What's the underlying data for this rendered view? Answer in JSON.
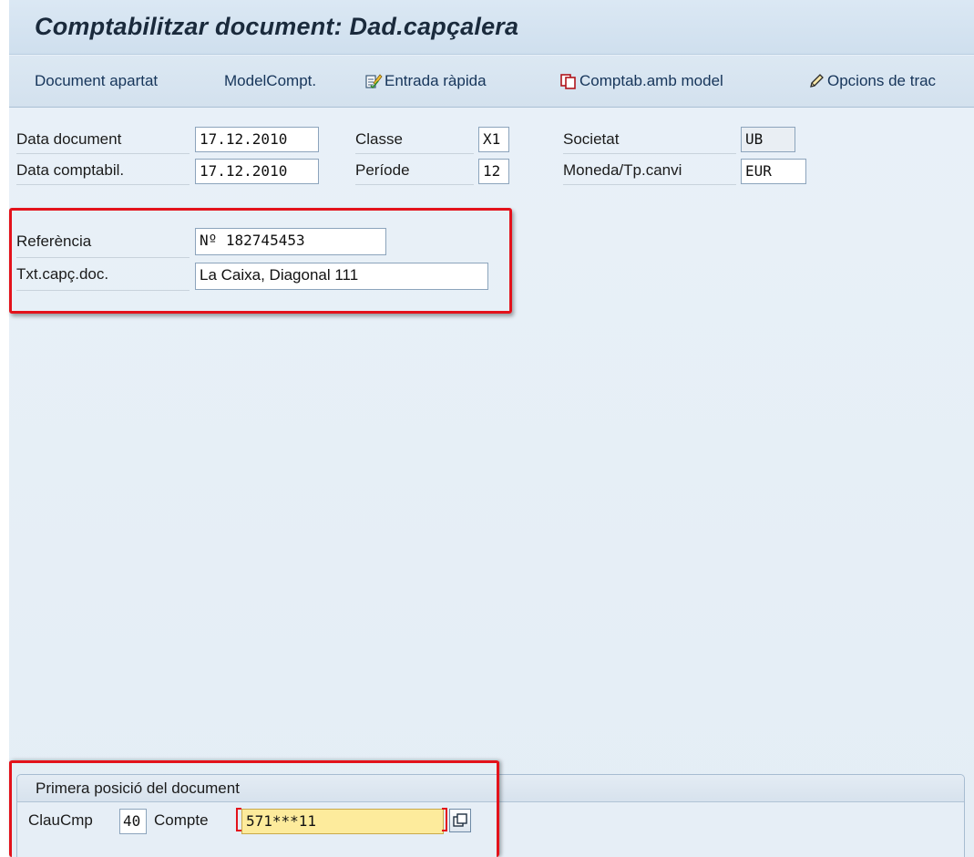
{
  "title": "Comptabilitzar document: Dad.capçalera",
  "toolbar": {
    "items": [
      {
        "label": "Document apartat",
        "icon": ""
      },
      {
        "label": "ModelCompt.",
        "icon": ""
      },
      {
        "label": "Entrada ràpida",
        "icon": "edit-list-icon"
      },
      {
        "label": "Comptab.amb model",
        "icon": "copy-icon"
      },
      {
        "label": "Opcions de trac",
        "icon": "pencil-icon"
      }
    ]
  },
  "header": {
    "data_document": {
      "label": "Data document",
      "value": "17.12.2010"
    },
    "data_comptabil": {
      "label": "Data comptabil.",
      "value": "17.12.2010"
    },
    "classe": {
      "label": "Classe",
      "value": "X1"
    },
    "periode": {
      "label": "Període",
      "value": "12"
    },
    "societat": {
      "label": "Societat",
      "value": "UB"
    },
    "moneda": {
      "label": "Moneda/Tp.canvi",
      "value": "EUR"
    },
    "referencia": {
      "label": "Referència",
      "value": "Nº 182745453"
    },
    "txt_capc": {
      "label": "Txt.capç.doc.",
      "value": "La Caixa, Diagonal 111"
    }
  },
  "first_item": {
    "title": "Primera posició del document",
    "claucmp": {
      "label": "ClauCmp",
      "value": "40"
    },
    "compte": {
      "label": "Compte",
      "value": "571***11"
    }
  },
  "colors": {
    "highlight": "#e3121b",
    "active_field": "#fdeb9c"
  }
}
